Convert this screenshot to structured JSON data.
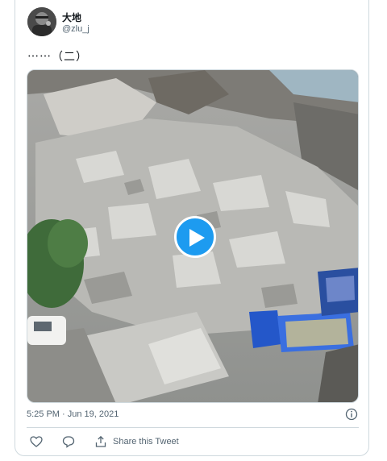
{
  "tweet": {
    "display_name": "大地",
    "handle": "@zlu_j",
    "text": "⋯⋯（二）",
    "timestamp": "5:25 PM · Jun 19, 2021"
  },
  "media": {
    "type": "video",
    "play_icon": "play-icon"
  },
  "actions": {
    "like_icon": "heart-icon",
    "reply_icon": "comment-icon",
    "share_icon": "share-icon",
    "share_label": "Share this Tweet",
    "info_icon": "info-icon"
  },
  "colors": {
    "accent": "#1d9bf0",
    "secondary_text": "#536471",
    "border": "#cfd9de"
  }
}
